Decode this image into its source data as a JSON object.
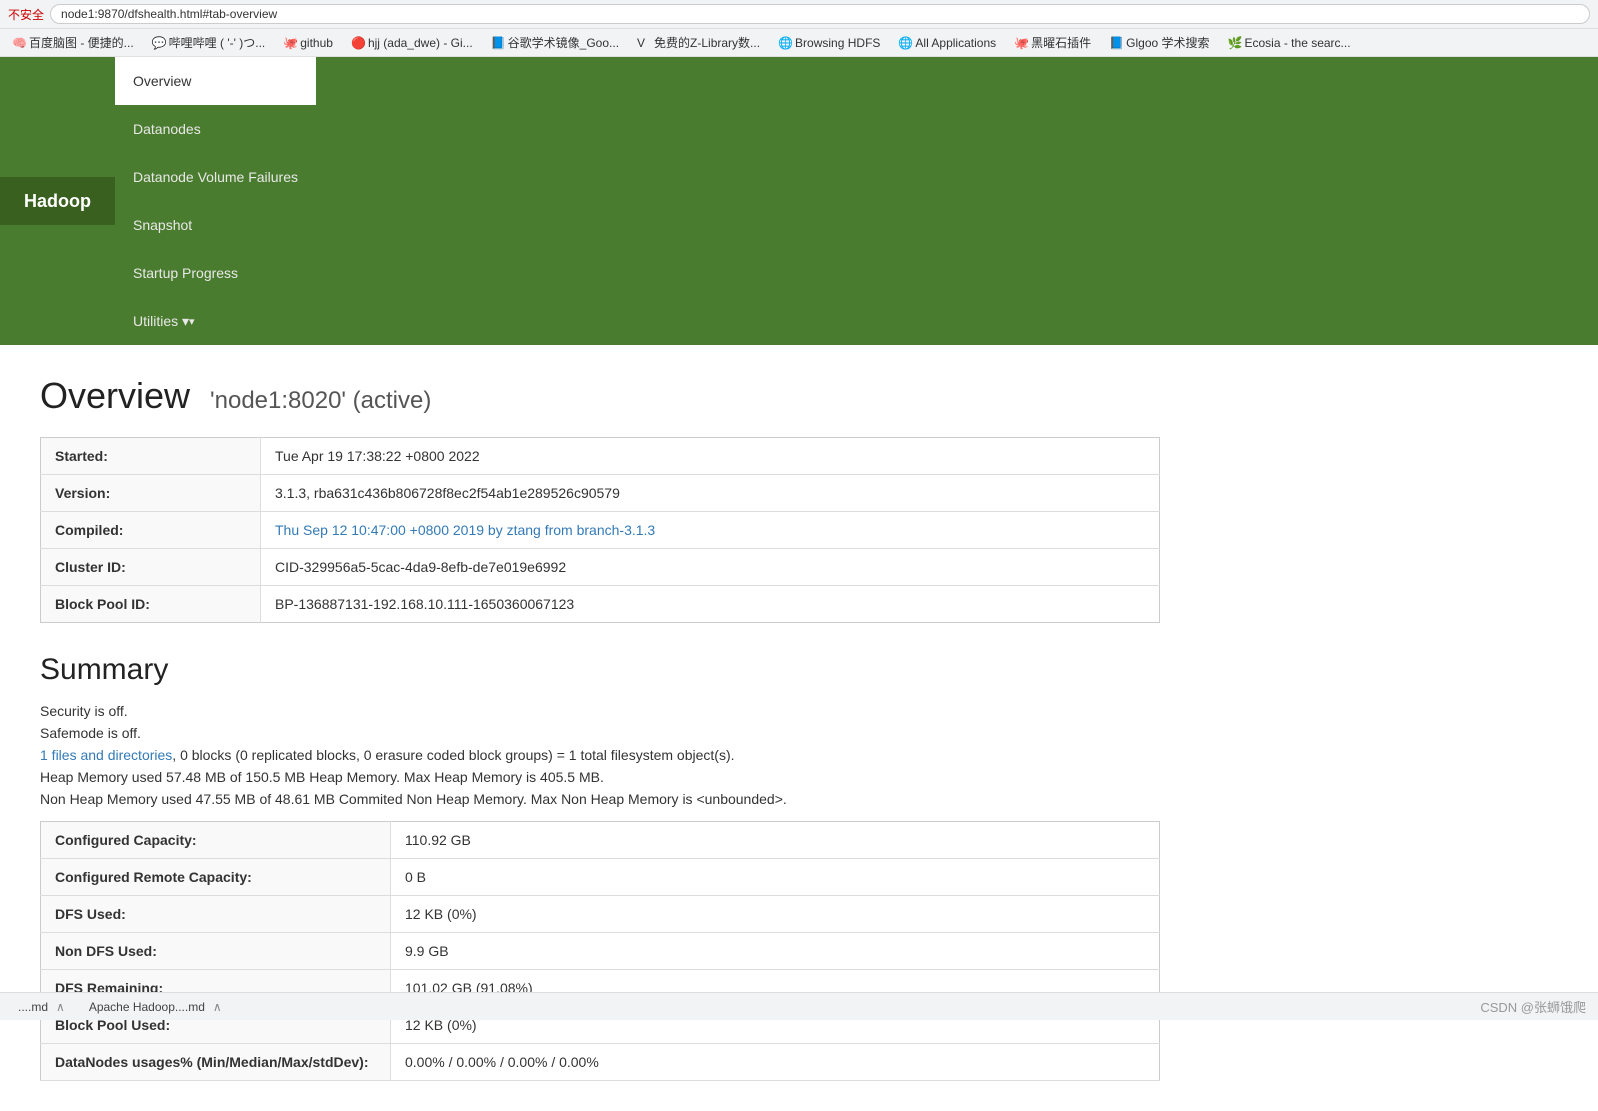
{
  "browser": {
    "insecure_label": "不安全",
    "url": "node1:9870/dfshealth.html#tab-overview"
  },
  "bookmarks": [
    {
      "icon": "🧠",
      "label": "百度脑图 - 便捷的..."
    },
    {
      "icon": "💬",
      "label": "哔哩哔哩 ( '-' )つ..."
    },
    {
      "icon": "🐙",
      "label": "github"
    },
    {
      "icon": "🔴",
      "label": "hjj (ada_dwe) - Gi..."
    },
    {
      "icon": "📘",
      "label": "谷歌学术镜像_Goo..."
    },
    {
      "icon": "V",
      "label": "免费的Z-Library数..."
    },
    {
      "icon": "🌐",
      "label": "Browsing HDFS"
    },
    {
      "icon": "🌐",
      "label": "All Applications"
    },
    {
      "icon": "🐙",
      "label": "黑曜石插件"
    },
    {
      "icon": "📘",
      "label": "Glgoo 学术搜索"
    },
    {
      "icon": "🌿",
      "label": "Ecosia - the searc..."
    }
  ],
  "nav": {
    "brand": "Hadoop",
    "items": [
      {
        "label": "Overview",
        "active": true,
        "dropdown": false
      },
      {
        "label": "Datanodes",
        "active": false,
        "dropdown": false
      },
      {
        "label": "Datanode Volume Failures",
        "active": false,
        "dropdown": false
      },
      {
        "label": "Snapshot",
        "active": false,
        "dropdown": false
      },
      {
        "label": "Startup Progress",
        "active": false,
        "dropdown": false
      },
      {
        "label": "Utilities",
        "active": false,
        "dropdown": true
      }
    ]
  },
  "page": {
    "title": "Overview",
    "subtitle": "'node1:8020' (active)"
  },
  "info_table": {
    "rows": [
      {
        "label": "Started:",
        "value": "Tue Apr 19 17:38:22 +0800 2022",
        "is_link": false
      },
      {
        "label": "Version:",
        "value": "3.1.3, rba631c436b806728f8ec2f54ab1e289526c90579",
        "is_link": false
      },
      {
        "label": "Compiled:",
        "value": "Thu Sep 12 10:47:00 +0800 2019 by ztang from branch-3.1.3",
        "is_link": true
      },
      {
        "label": "Cluster ID:",
        "value": "CID-329956a5-5cac-4da9-8efb-de7e019e6992",
        "is_link": false
      },
      {
        "label": "Block Pool ID:",
        "value": "BP-136887131-192.168.10.111-1650360067123",
        "is_link": false
      }
    ]
  },
  "summary": {
    "title": "Summary",
    "lines": [
      {
        "text": "Security is off.",
        "has_link": false
      },
      {
        "text": "Safemode is off.",
        "has_link": false
      },
      {
        "text": "1 files and directories, 0 blocks (0 replicated blocks, 0 erasure coded block groups) = 1 total filesystem object(s).",
        "has_link": true,
        "link_text": "1 files and directories"
      },
      {
        "text": "Heap Memory used 57.48 MB of 150.5 MB Heap Memory. Max Heap Memory is 405.5 MB.",
        "has_link": false
      },
      {
        "text": "Non Heap Memory used 47.55 MB of 48.61 MB Commited Non Heap Memory. Max Non Heap Memory is <unbounded>.",
        "has_link": false
      }
    ],
    "table_rows": [
      {
        "label": "Configured Capacity:",
        "value": "110.92 GB"
      },
      {
        "label": "Configured Remote Capacity:",
        "value": "0 B"
      },
      {
        "label": "DFS Used:",
        "value": "12 KB (0%)"
      },
      {
        "label": "Non DFS Used:",
        "value": "9.9 GB"
      },
      {
        "label": "DFS Remaining:",
        "value": "101.02 GB (91.08%)"
      },
      {
        "label": "Block Pool Used:",
        "value": "12 KB (0%)"
      },
      {
        "label": "DataNodes usages% (Min/Median/Max/stdDev):",
        "value": "0.00% / 0.00% / 0.00% / 0.00%"
      }
    ]
  },
  "bottom_bar": {
    "tabs": [
      {
        "label": "....md",
        "has_close": true
      },
      {
        "label": "Apache Hadoop....md",
        "has_close": true
      }
    ],
    "right_text": "CSDN @张蛳饿爬"
  }
}
